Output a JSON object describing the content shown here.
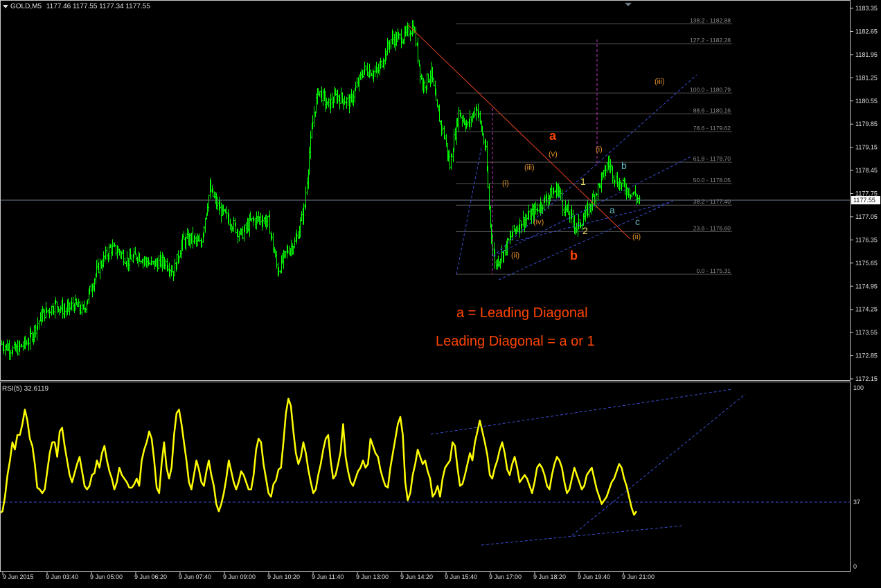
{
  "header": {
    "title": "GOLD,M5",
    "quote": "1177.46 1177.55 1177.34 1177.55",
    "menu_icon": "triangle-down-icon"
  },
  "colors": {
    "background": "#000000",
    "candle": "#00FF00",
    "rsi_line": "#FFFF00",
    "trendline": "#3A4FD0",
    "fib": "#5A5A5A",
    "price_line": "#6E7C8A",
    "wave_red": "#FF4500",
    "wave_orange": "#E0902A",
    "wave_cyan": "#66B8C0",
    "vline": "#C030C0"
  },
  "chart_data": [
    {
      "type": "candlestick",
      "title": "GOLD,M5",
      "price_scale": [
        "1183.35",
        "1182.65",
        "1181.95",
        "1181.25",
        "1180.55",
        "1179.85",
        "1179.15",
        "1178.45",
        "1177.75",
        "1177.05",
        "1176.35",
        "1175.65",
        "1174.95",
        "1174.25",
        "1173.55",
        "1172.85",
        "1172.15"
      ],
      "ylim": [
        1172.15,
        1183.35
      ],
      "current_price": "1177.55",
      "x_ticks": [
        "9 Jun 2015",
        "9 Jun 03:40",
        "9 Jun 05:00",
        "9 Jun 06:20",
        "9 Jun 07:40",
        "9 Jun 09:00",
        "9 Jun 10:20",
        "9 Jun 11:40",
        "9 Jun 13:00",
        "9 Jun 14:20",
        "9 Jun 15:40",
        "9 Jun 17:00",
        "9 Jun 18:20",
        "9 Jun 19:40",
        "9 Jun 21:00"
      ],
      "close_path": [
        [
          0,
          1173.2
        ],
        [
          3,
          1173.0
        ],
        [
          6,
          1173.3
        ],
        [
          9,
          1174.1
        ],
        [
          12,
          1174.4
        ],
        [
          14,
          1174.2
        ],
        [
          16,
          1174.4
        ],
        [
          18,
          1174.2
        ],
        [
          21,
          1175.4
        ],
        [
          24,
          1176.1
        ],
        [
          26,
          1176.0
        ],
        [
          28,
          1175.7
        ],
        [
          30,
          1175.9
        ],
        [
          33,
          1175.6
        ],
        [
          36,
          1175.7
        ],
        [
          38,
          1175.4
        ],
        [
          40,
          1176.3
        ],
        [
          42,
          1176.4
        ],
        [
          44,
          1176.2
        ],
        [
          46,
          1177.9
        ],
        [
          48,
          1177.3
        ],
        [
          50,
          1177.0
        ],
        [
          53,
          1176.5
        ],
        [
          55,
          1176.9
        ],
        [
          57,
          1177.0
        ],
        [
          59,
          1176.9
        ],
        [
          61,
          1175.4
        ],
        [
          63,
          1176.0
        ],
        [
          65,
          1176.3
        ],
        [
          67,
          1177.4
        ],
        [
          68,
          1179.0
        ],
        [
          69,
          1180.2
        ],
        [
          70,
          1180.9
        ],
        [
          72,
          1180.4
        ],
        [
          74,
          1180.7
        ],
        [
          77,
          1180.5
        ],
        [
          80,
          1181.5
        ],
        [
          83,
          1181.4
        ],
        [
          86,
          1182.4
        ],
        [
          89,
          1182.5
        ],
        [
          91,
          1182.8
        ],
        [
          93,
          1181.0
        ],
        [
          95,
          1181.4
        ],
        [
          96,
          1180.4
        ],
        [
          98,
          1179.4
        ],
        [
          99,
          1178.6
        ],
        [
          101,
          1180.2
        ],
        [
          103,
          1179.8
        ],
        [
          105,
          1180.4
        ],
        [
          107,
          1179.0
        ],
        [
          108,
          1176.8
        ],
        [
          109,
          1175.6
        ],
        [
          111,
          1176.0
        ],
        [
          113,
          1176.6
        ],
        [
          115,
          1176.9
        ],
        [
          117,
          1177.1
        ],
        [
          119,
          1177.4
        ],
        [
          121,
          1177.7
        ],
        [
          123,
          1177.9
        ],
        [
          124,
          1177.4
        ],
        [
          126,
          1177.0
        ],
        [
          127,
          1176.7
        ],
        [
          129,
          1177.1
        ],
        [
          131,
          1177.7
        ],
        [
          133,
          1178.3
        ],
        [
          134,
          1178.7
        ],
        [
          136,
          1178.1
        ],
        [
          138,
          1177.9
        ],
        [
          140,
          1177.7
        ],
        [
          141,
          1177.5
        ]
      ],
      "fibonacci_levels": [
        {
          "label": "138.2 - 1182.88",
          "price": 1182.88
        },
        {
          "label": "127.2 - 1182.28",
          "price": 1182.28
        },
        {
          "label": "100.0 - 1180.79",
          "price": 1180.79
        },
        {
          "label": "88.6 - 1180.16",
          "price": 1180.16
        },
        {
          "label": "78.6 - 1179.62",
          "price": 1179.62
        },
        {
          "label": "61.8 - 1178.70",
          "price": 1178.7
        },
        {
          "label": "50.0 - 1178.05",
          "price": 1178.05
        },
        {
          "label": "38.2 - 1177.40",
          "price": 1177.4
        },
        {
          "label": "23.6 - 1176.60",
          "price": 1176.6
        },
        {
          "label": "0.0 - 1175.31",
          "price": 1175.31
        }
      ],
      "wave_labels": [
        {
          "text": "a",
          "color": "red",
          "bold": true
        },
        {
          "text": "b",
          "color": "red",
          "bold": true
        },
        {
          "text": "(i)",
          "color": "orange"
        },
        {
          "text": "(ii)",
          "color": "orange"
        },
        {
          "text": "(iii)",
          "color": "orange"
        },
        {
          "text": "(iv)",
          "color": "orange"
        },
        {
          "text": "(v)",
          "color": "orange"
        },
        {
          "text": "(i)",
          "color": "orange"
        },
        {
          "text": "(ii)",
          "color": "orange"
        },
        {
          "text": "(iii)",
          "color": "orange"
        },
        {
          "text": "1",
          "color": "yellow"
        },
        {
          "text": "2",
          "color": "yellow"
        },
        {
          "text": "a",
          "color": "cyan"
        },
        {
          "text": "b",
          "color": "cyan"
        },
        {
          "text": "c",
          "color": "cyan"
        }
      ],
      "annotations": [
        "a = Leading Diagonal",
        "Leading Diagonal = a or 1"
      ]
    },
    {
      "type": "line",
      "title": "RSI(5) 32.6119",
      "ylim": [
        0,
        100
      ],
      "ticks": [
        "100",
        "37",
        "0"
      ],
      "level": 37,
      "series": [
        {
          "values": [
            31,
            32,
            40,
            52,
            60,
            70,
            66,
            74,
            74,
            80,
            88,
            82,
            72,
            68,
            58,
            45,
            44,
            42,
            44,
            54,
            64,
            70,
            70,
            62,
            76,
            78,
            68,
            60,
            52,
            48,
            53,
            58,
            62,
            54,
            46,
            44,
            46,
            52,
            53,
            60,
            56,
            64,
            68,
            60,
            54,
            50,
            44,
            48,
            56,
            52,
            50,
            48,
            45,
            45,
            47,
            50,
            46,
            60,
            66,
            70,
            76,
            72,
            60,
            45,
            42,
            58,
            70,
            56,
            50,
            56,
            74,
            86,
            88,
            80,
            70,
            60,
            48,
            44,
            52,
            60,
            55,
            48,
            46,
            54,
            60,
            52,
            46,
            36,
            32,
            36,
            42,
            50,
            60,
            54,
            48,
            44,
            48,
            54,
            52,
            48,
            44,
            44,
            52,
            66,
            72,
            70,
            58,
            50,
            42,
            40,
            47,
            49,
            55,
            56,
            70,
            86,
            94,
            90,
            76,
            64,
            58,
            62,
            70,
            64,
            55,
            48,
            42,
            44,
            52,
            58,
            66,
            72,
            74,
            60,
            50,
            52,
            58,
            65,
            80,
            62,
            54,
            48,
            46,
            50,
            54,
            56,
            60,
            56,
            58,
            72,
            68,
            64,
            62,
            55,
            50,
            46,
            45,
            56,
            64,
            72,
            80,
            84,
            74,
            48,
            38,
            42,
            52,
            58,
            66,
            62,
            58,
            60,
            54,
            50,
            40,
            42,
            46,
            40,
            50,
            56,
            58,
            60,
            70,
            68,
            56,
            46,
            47,
            52,
            58,
            64,
            60,
            70,
            76,
            82,
            76,
            70,
            63,
            52,
            50,
            56,
            60,
            66,
            70,
            64,
            55,
            52,
            58,
            62,
            56,
            48,
            50,
            52,
            50,
            46,
            42,
            48,
            56,
            58,
            56,
            52,
            46,
            44,
            52,
            58,
            62,
            60,
            56,
            48,
            42,
            44,
            50,
            56,
            52,
            48,
            44,
            46,
            52,
            54,
            56,
            50,
            44,
            40,
            36,
            38,
            40,
            44,
            48,
            50,
            54,
            58,
            56,
            50,
            46,
            40,
            34,
            30,
            32
          ]
        }
      ]
    }
  ]
}
